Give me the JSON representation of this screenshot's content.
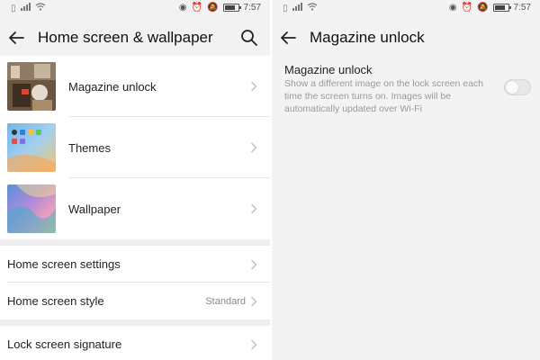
{
  "status_bar": {
    "time": "7:57",
    "icons": [
      "sim-icon",
      "signal-icon",
      "wifi-icon",
      "eye-icon",
      "alarm-icon",
      "silent-icon",
      "battery-icon"
    ]
  },
  "left": {
    "header": {
      "title": "Home screen & wallpaper",
      "back_icon": "back-arrow-icon",
      "search_icon": "search-icon"
    },
    "items": [
      {
        "label": "Magazine unlock"
      },
      {
        "label": "Themes"
      },
      {
        "label": "Wallpaper"
      }
    ],
    "settings": [
      {
        "label": "Home screen settings"
      },
      {
        "label": "Home screen style",
        "value": "Standard"
      },
      {
        "label": "Lock screen signature"
      }
    ]
  },
  "right": {
    "header": {
      "title": "Magazine unlock",
      "back_icon": "back-arrow-icon"
    },
    "setting": {
      "title": "Magazine unlock",
      "description": "Show a different image on the lock screen each time the screen turns on. Images will be automatically updated over Wi-Fi",
      "enabled": false
    }
  },
  "colors": {
    "background": "#f2f2f2",
    "row": "#ffffff",
    "text": "#222222",
    "secondary": "#9a9a9a"
  }
}
